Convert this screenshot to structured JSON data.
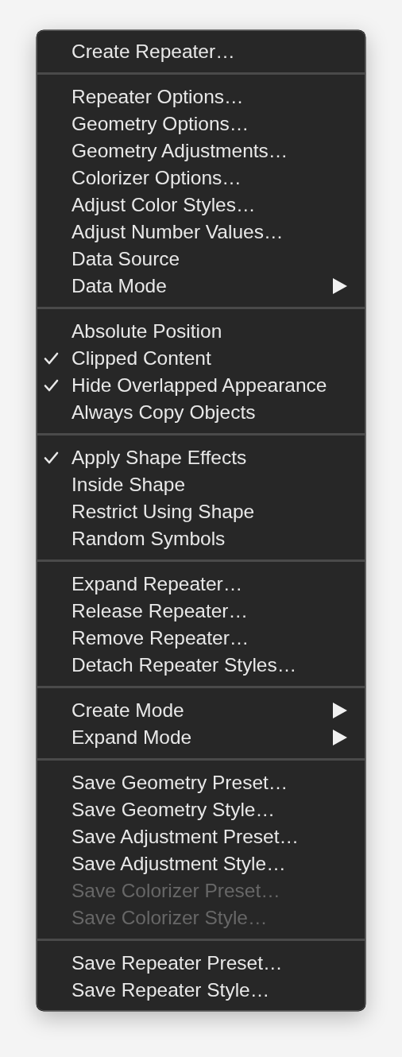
{
  "menu": {
    "sections": [
      {
        "items": [
          {
            "label": "Create Repeater…",
            "checked": false,
            "disabled": false,
            "submenu": false
          }
        ]
      },
      {
        "items": [
          {
            "label": "Repeater Options…",
            "checked": false,
            "disabled": false,
            "submenu": false
          },
          {
            "label": "Geometry Options…",
            "checked": false,
            "disabled": false,
            "submenu": false
          },
          {
            "label": "Geometry Adjustments…",
            "checked": false,
            "disabled": false,
            "submenu": false
          },
          {
            "label": "Colorizer Options…",
            "checked": false,
            "disabled": false,
            "submenu": false
          },
          {
            "label": "Adjust Color Styles…",
            "checked": false,
            "disabled": false,
            "submenu": false
          },
          {
            "label": "Adjust Number Values…",
            "checked": false,
            "disabled": false,
            "submenu": false
          },
          {
            "label": "Data Source",
            "checked": false,
            "disabled": false,
            "submenu": false
          },
          {
            "label": "Data Mode",
            "checked": false,
            "disabled": false,
            "submenu": true
          }
        ]
      },
      {
        "items": [
          {
            "label": "Absolute Position",
            "checked": false,
            "disabled": false,
            "submenu": false
          },
          {
            "label": "Clipped Content",
            "checked": true,
            "disabled": false,
            "submenu": false
          },
          {
            "label": "Hide Overlapped Appearance",
            "checked": true,
            "disabled": false,
            "submenu": false
          },
          {
            "label": "Always Copy Objects",
            "checked": false,
            "disabled": false,
            "submenu": false
          }
        ]
      },
      {
        "items": [
          {
            "label": "Apply Shape Effects",
            "checked": true,
            "disabled": false,
            "submenu": false
          },
          {
            "label": "Inside Shape",
            "checked": false,
            "disabled": false,
            "submenu": false
          },
          {
            "label": "Restrict Using Shape",
            "checked": false,
            "disabled": false,
            "submenu": false
          },
          {
            "label": "Random Symbols",
            "checked": false,
            "disabled": false,
            "submenu": false
          }
        ]
      },
      {
        "items": [
          {
            "label": "Expand Repeater…",
            "checked": false,
            "disabled": false,
            "submenu": false
          },
          {
            "label": "Release Repeater…",
            "checked": false,
            "disabled": false,
            "submenu": false
          },
          {
            "label": "Remove Repeater…",
            "checked": false,
            "disabled": false,
            "submenu": false
          },
          {
            "label": "Detach Repeater Styles…",
            "checked": false,
            "disabled": false,
            "submenu": false
          }
        ]
      },
      {
        "items": [
          {
            "label": "Create Mode",
            "checked": false,
            "disabled": false,
            "submenu": true
          },
          {
            "label": "Expand Mode",
            "checked": false,
            "disabled": false,
            "submenu": true
          }
        ]
      },
      {
        "items": [
          {
            "label": "Save Geometry Preset…",
            "checked": false,
            "disabled": false,
            "submenu": false
          },
          {
            "label": "Save Geometry Style…",
            "checked": false,
            "disabled": false,
            "submenu": false
          },
          {
            "label": "Save Adjustment Preset…",
            "checked": false,
            "disabled": false,
            "submenu": false
          },
          {
            "label": "Save Adjustment Style…",
            "checked": false,
            "disabled": false,
            "submenu": false
          },
          {
            "label": "Save Colorizer Preset…",
            "checked": false,
            "disabled": true,
            "submenu": false
          },
          {
            "label": "Save Colorizer Style…",
            "checked": false,
            "disabled": true,
            "submenu": false
          }
        ]
      },
      {
        "items": [
          {
            "label": "Save Repeater Preset…",
            "checked": false,
            "disabled": false,
            "submenu": false
          },
          {
            "label": "Save Repeater Style…",
            "checked": false,
            "disabled": false,
            "submenu": false
          }
        ]
      }
    ]
  }
}
